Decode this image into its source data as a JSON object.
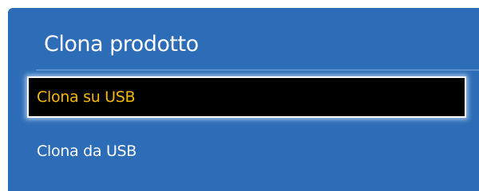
{
  "panel": {
    "title": "Clona prodotto"
  },
  "menu": {
    "items": [
      {
        "label": "Clona su USB",
        "selected": true
      },
      {
        "label": "Clona da USB",
        "selected": false
      }
    ]
  },
  "colors": {
    "panel_bg": "#2d6db7",
    "selected_bg": "#000000",
    "selected_text": "#f5b800",
    "text": "#ffffff"
  }
}
